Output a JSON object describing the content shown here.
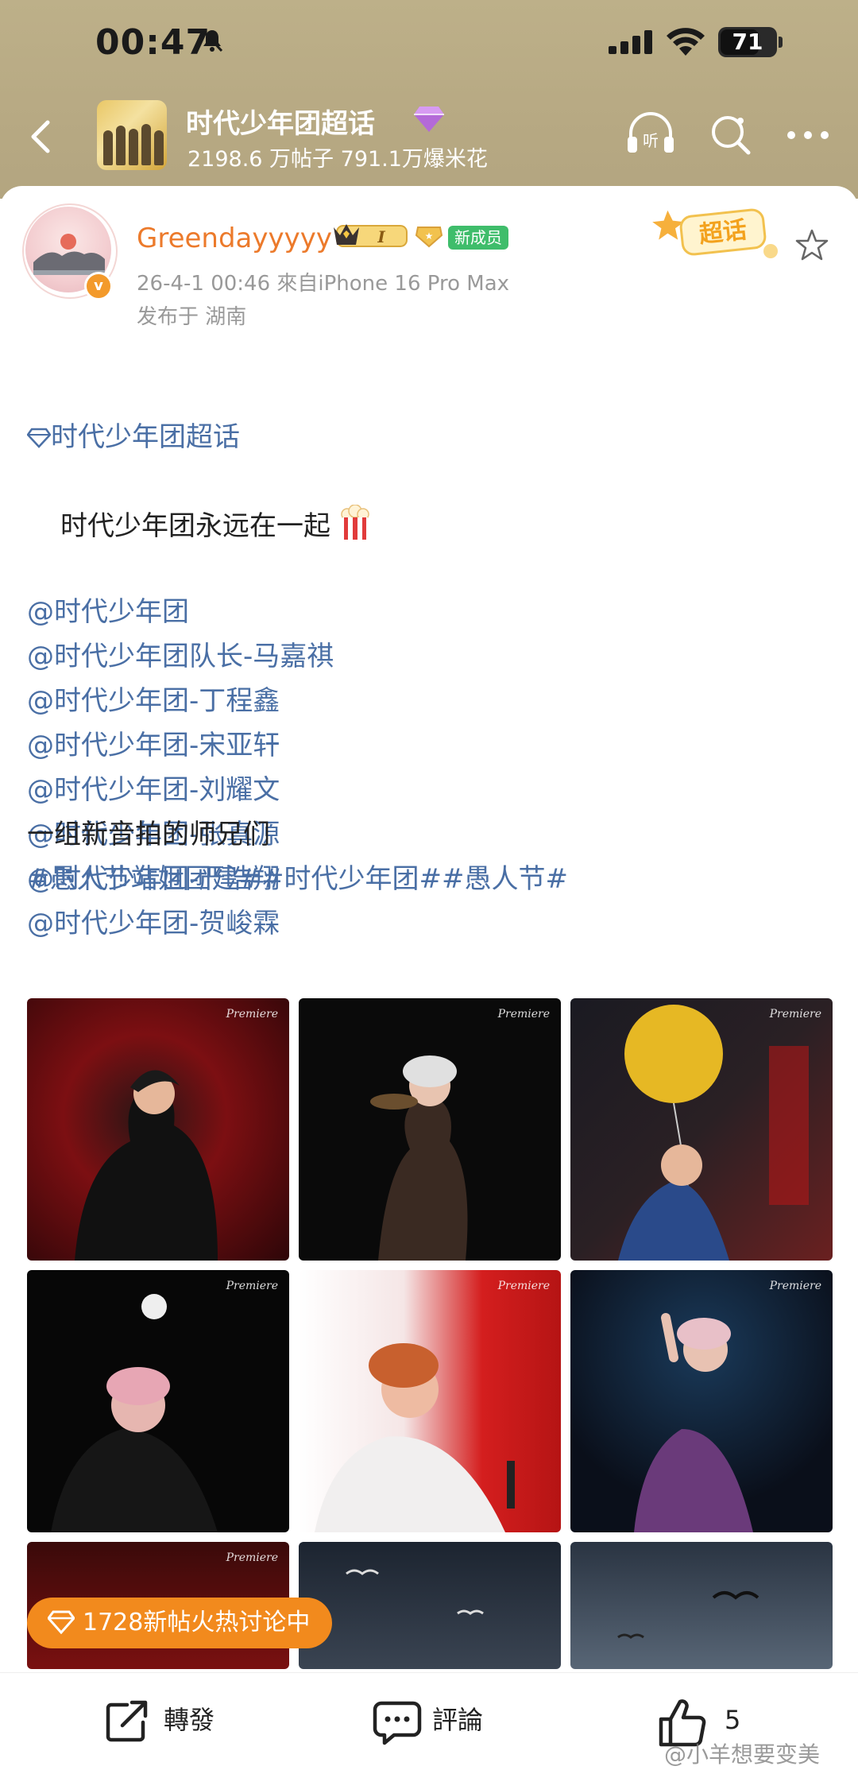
{
  "status": {
    "time": "00:47",
    "battery": "71",
    "battery_level": 0.71
  },
  "header": {
    "title": "时代少年团超话",
    "stats": "2198.6 万帖子  791.1万爆米花"
  },
  "post": {
    "username": "Greendayyyyy",
    "level_badge": "I",
    "new_member_badge": "新成员",
    "timestamp_source": "26-4-1 00:46  來自iPhone 16 Pro Max",
    "location": "发布于 湖南",
    "sticker": "超话",
    "topic_link": "时代少年团超话",
    "content_line": "时代少年团永远在一起",
    "mentions": [
      "@时代少年团",
      "@时代少年团队长-马嘉祺",
      "@时代少年团-丁程鑫",
      "@时代少年团-宋亚轩",
      "@时代少年团-刘耀文",
      "@时代少年团-张真源",
      "@时代少年团-严浩翔",
      "@时代少年团-贺峻霖"
    ],
    "caption": "一组新音拍的师兄们",
    "hashtags": "#愚人节站姐团建##时代少年团##愚人节#"
  },
  "hot_pill": "1728新帖火热讨论中",
  "bottom_bar": {
    "repost": "轉發",
    "comment": "評論",
    "like_count": "5"
  },
  "watermark": "@小羊想要变美",
  "colors": {
    "header_bg": "#bdb089",
    "username": "#ec7a2b",
    "link": "#4a6fa5",
    "hot_pill": "#f28a1d",
    "new_badge": "#3fbd6b"
  }
}
